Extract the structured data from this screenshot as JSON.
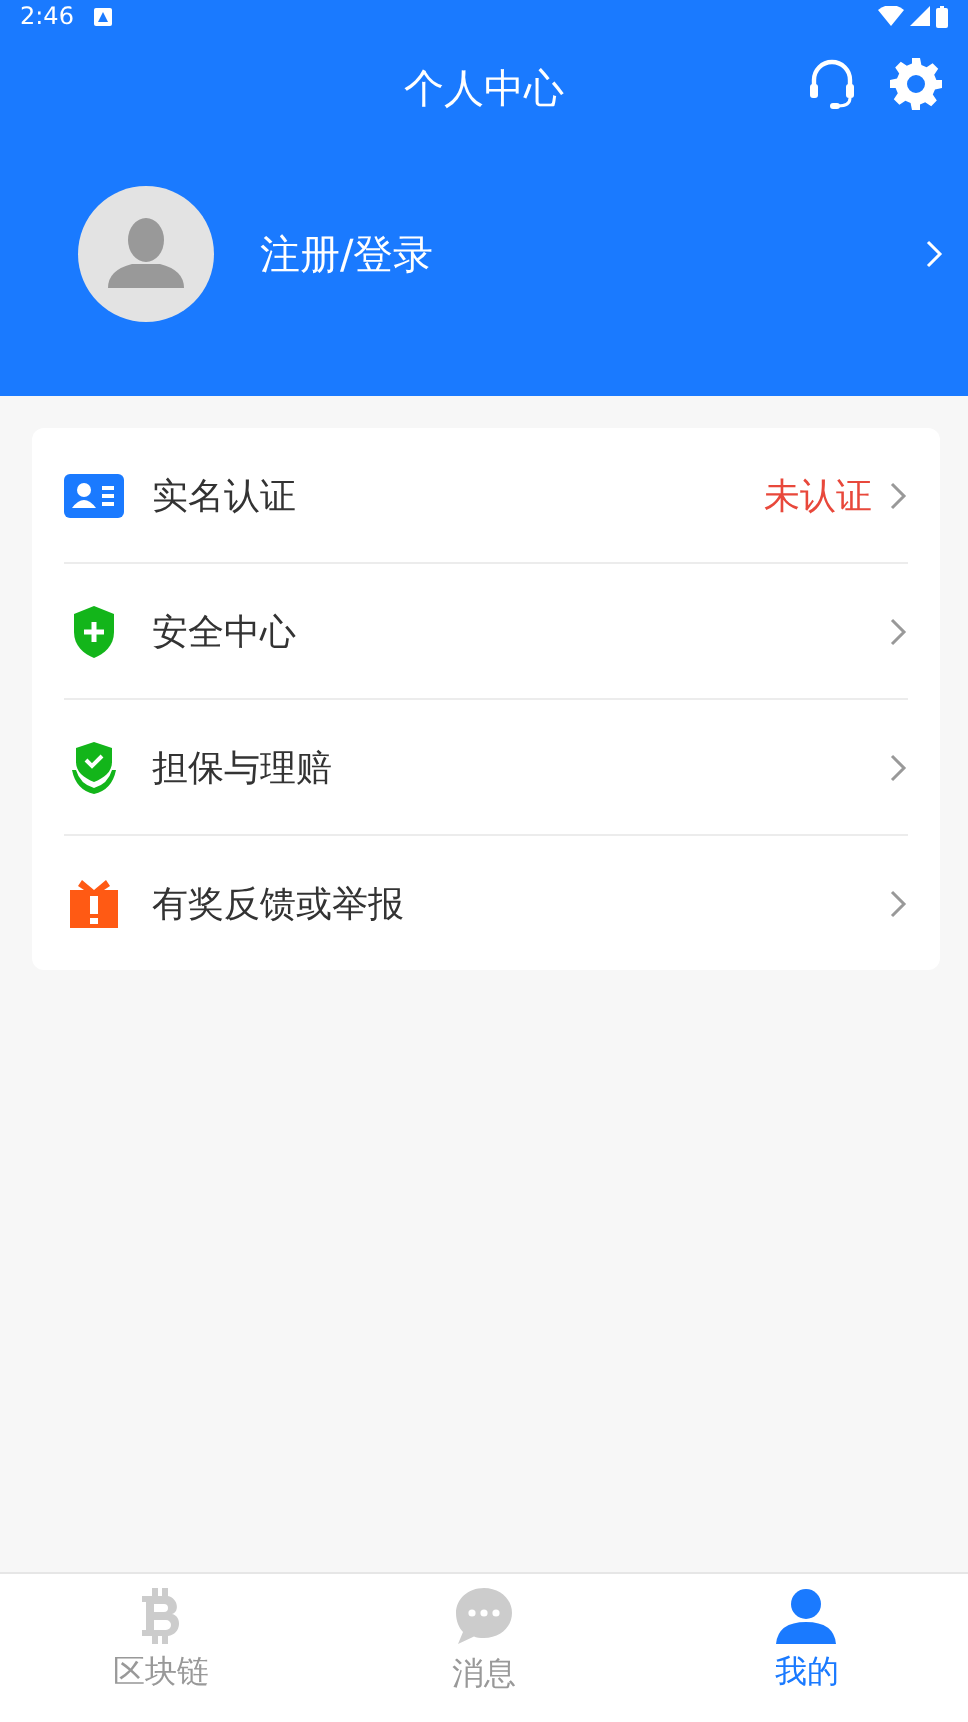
{
  "status_bar": {
    "time": "2:46"
  },
  "header": {
    "title": "个人中心"
  },
  "profile": {
    "label": "注册/登录"
  },
  "menu": [
    {
      "kind": "id",
      "label": "实名认证",
      "status": "未认证"
    },
    {
      "kind": "shield",
      "label": "安全中心"
    },
    {
      "kind": "guarantee",
      "label": "担保与理赔"
    },
    {
      "kind": "gift",
      "label": "有奖反馈或举报"
    }
  ],
  "tabs": [
    {
      "kind": "coin",
      "label": "区块链",
      "selected": false
    },
    {
      "kind": "chat",
      "label": "消息",
      "selected": false
    },
    {
      "kind": "user",
      "label": "我的",
      "selected": true
    }
  ]
}
